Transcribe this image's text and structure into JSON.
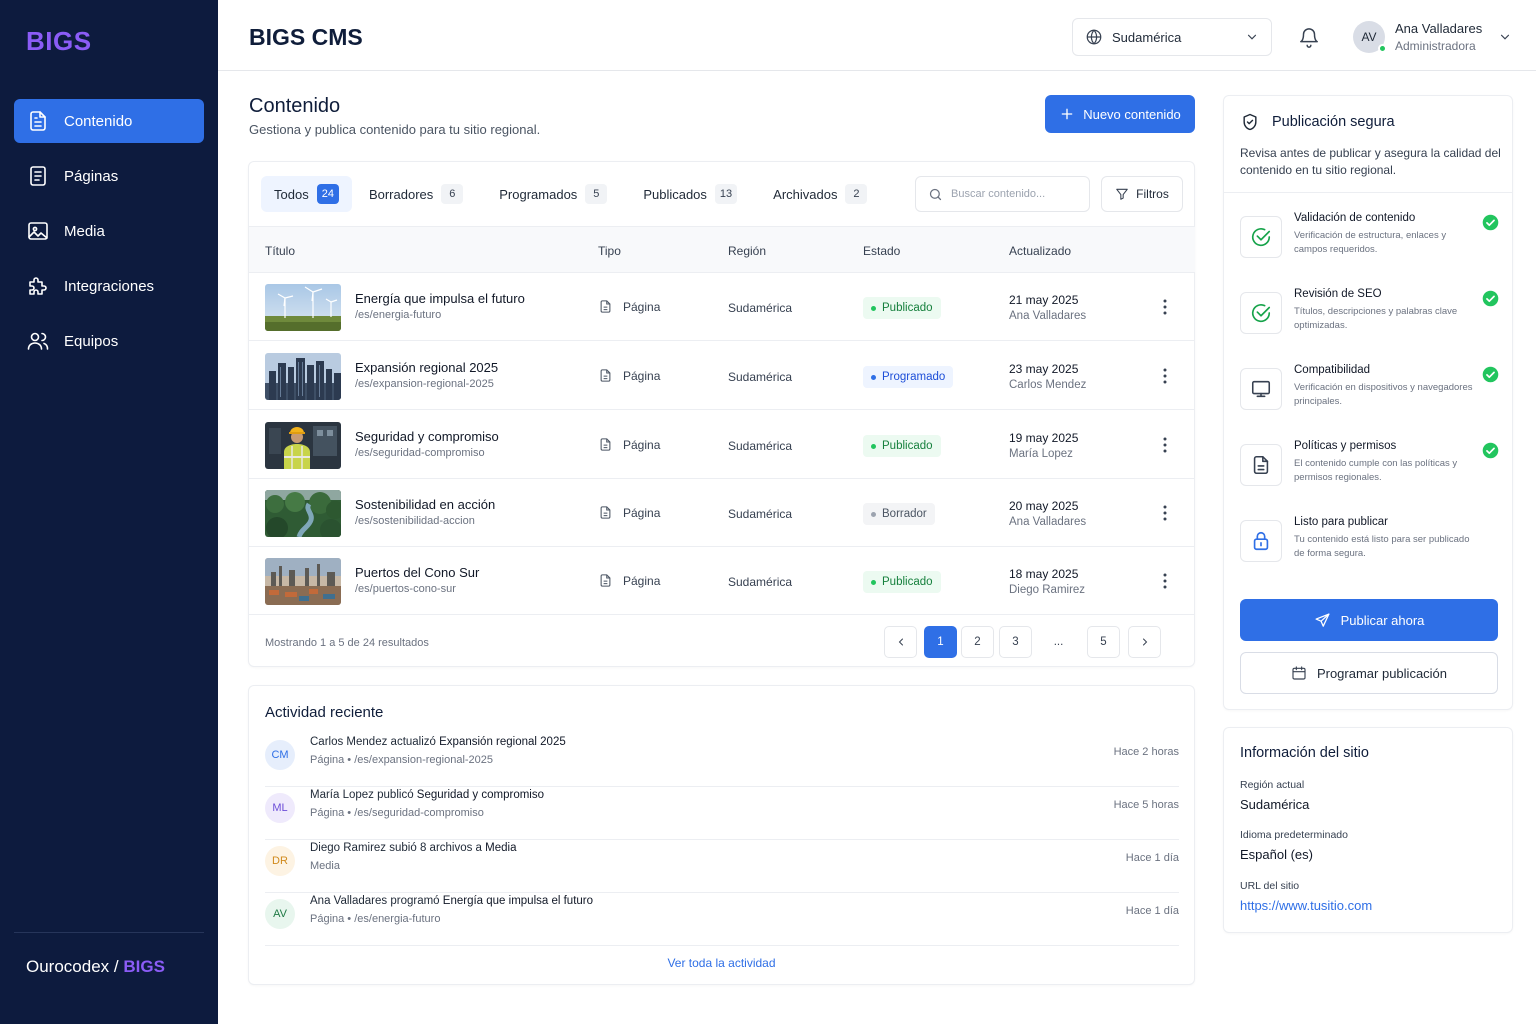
{
  "sidebar": {
    "logo": "BIGS",
    "items": [
      {
        "label": "Contenido",
        "icon": "document-icon"
      },
      {
        "label": "Páginas",
        "icon": "pages-icon"
      },
      {
        "label": "Media",
        "icon": "image-icon"
      },
      {
        "label": "Integraciones",
        "icon": "puzzle-icon"
      },
      {
        "label": "Equipos",
        "icon": "users-icon"
      }
    ],
    "brand_prefix": "Ourocodex /",
    "brand_accent": "BIGS"
  },
  "header": {
    "title": "BIGS CMS",
    "region_selector": "Sudamérica",
    "user": {
      "initials": "AV",
      "name": "Ana Valladares",
      "role": "Administradora"
    }
  },
  "main": {
    "title": "Contenido",
    "subtitle": "Gestiona y publica contenido para tu sitio regional.",
    "new_button": "Nuevo contenido",
    "tabs": [
      {
        "label": "Todos",
        "count": "24"
      },
      {
        "label": "Borradores",
        "count": "6"
      },
      {
        "label": "Programados",
        "count": "5"
      },
      {
        "label": "Publicados",
        "count": "13"
      },
      {
        "label": "Archivados",
        "count": "2"
      }
    ],
    "search_placeholder": "Buscar contenido...",
    "filter_button": "Filtros",
    "columns": [
      "Título",
      "Tipo",
      "Región",
      "Estado",
      "Actualizado"
    ],
    "rows": [
      {
        "title": "Energía que impulsa el futuro",
        "slug": "/es/energia-futuro",
        "type": "Página",
        "region": "Sudamérica",
        "status": "Publicado",
        "date": "21 may 2025",
        "author": "Ana Valladares"
      },
      {
        "title": "Expansión regional 2025",
        "slug": "/es/expansion-regional-2025",
        "type": "Página",
        "region": "Sudamérica",
        "status": "Programado",
        "date": "23 may 2025",
        "author": "Carlos Mendez"
      },
      {
        "title": "Seguridad y compromiso",
        "slug": "/es/seguridad-compromiso",
        "type": "Página",
        "region": "Sudamérica",
        "status": "Publicado",
        "date": "19 may 2025",
        "author": "María Lopez"
      },
      {
        "title": "Sostenibilidad en acción",
        "slug": "/es/sostenibilidad-accion",
        "type": "Página",
        "region": "Sudamérica",
        "status": "Borrador",
        "date": "20 may 2025",
        "author": "Ana Valladares"
      },
      {
        "title": "Puertos del Cono Sur",
        "slug": "/es/puertos-cono-sur",
        "type": "Página",
        "region": "Sudamérica",
        "status": "Publicado",
        "date": "18 may 2025",
        "author": "Diego Ramirez"
      }
    ],
    "showing": "Mostrando 1 a 5 de 24 resultados",
    "pagination": [
      "1",
      "2",
      "3",
      "...",
      "5"
    ]
  },
  "activity": {
    "title": "Actividad reciente",
    "items": [
      {
        "initials": "CM",
        "actor": "Carlos Mendez",
        "action": "actualizó",
        "target": "Expansión regional 2025",
        "meta": "Página • /es/expansion-regional-2025",
        "time": "Hace 2 horas"
      },
      {
        "initials": "ML",
        "actor": "María Lopez",
        "action": "publicó",
        "target": "Seguridad y compromiso",
        "meta": "Página • /es/seguridad-compromiso",
        "time": "Hace 5 horas"
      },
      {
        "initials": "DR",
        "actor": "Diego Ramirez",
        "action": "subió 8 archivos a",
        "target": "Media",
        "meta": "Media",
        "time": "Hace 1 día"
      },
      {
        "initials": "AV",
        "actor": "Ana Valladares",
        "action": "programó",
        "target": "Energía que impulsa el futuro",
        "meta": "Página • /es/energia-futuro",
        "time": "Hace 1 día"
      }
    ],
    "view_all": "Ver toda la actividad"
  },
  "publish_panel": {
    "title": "Publicación segura",
    "description": "Revisa antes de publicar y asegura la calidad del contenido en tu sitio regional.",
    "checks": [
      {
        "title": "Validación de contenido",
        "desc": "Verificación de estructura, enlaces y campos requeridos.",
        "icon": "check-circle-icon"
      },
      {
        "title": "Revisión de SEO",
        "desc": "Títulos, descripciones y palabras clave optimizadas.",
        "icon": "check-circle-icon"
      },
      {
        "title": "Compatibilidad",
        "desc": "Verificación en dispositivos y navegadores principales.",
        "icon": "monitor-icon"
      },
      {
        "title": "Políticas y permisos",
        "desc": "El contenido cumple con las políticas y permisos regionales.",
        "icon": "document-icon"
      },
      {
        "title": "Listo para publicar",
        "desc": "Tu contenido está listo para ser publicado de forma segura.",
        "icon": "lock-icon"
      }
    ],
    "publish_button": "Publicar ahora",
    "schedule_button": "Programar publicación"
  },
  "site_info": {
    "title": "Información del sitio",
    "region_label": "Región actual",
    "region_value": "Sudamérica",
    "language_label": "Idioma predeterminado",
    "language_value": "Español (es)",
    "url_label": "URL del sitio",
    "url_value": "https://www.tusitio.com"
  },
  "colors": {
    "sidebar_bg": "#0d1b3e",
    "accent": "#2f6fe6",
    "brand_purple": "#8b5cf6",
    "success": "#22c55e"
  }
}
